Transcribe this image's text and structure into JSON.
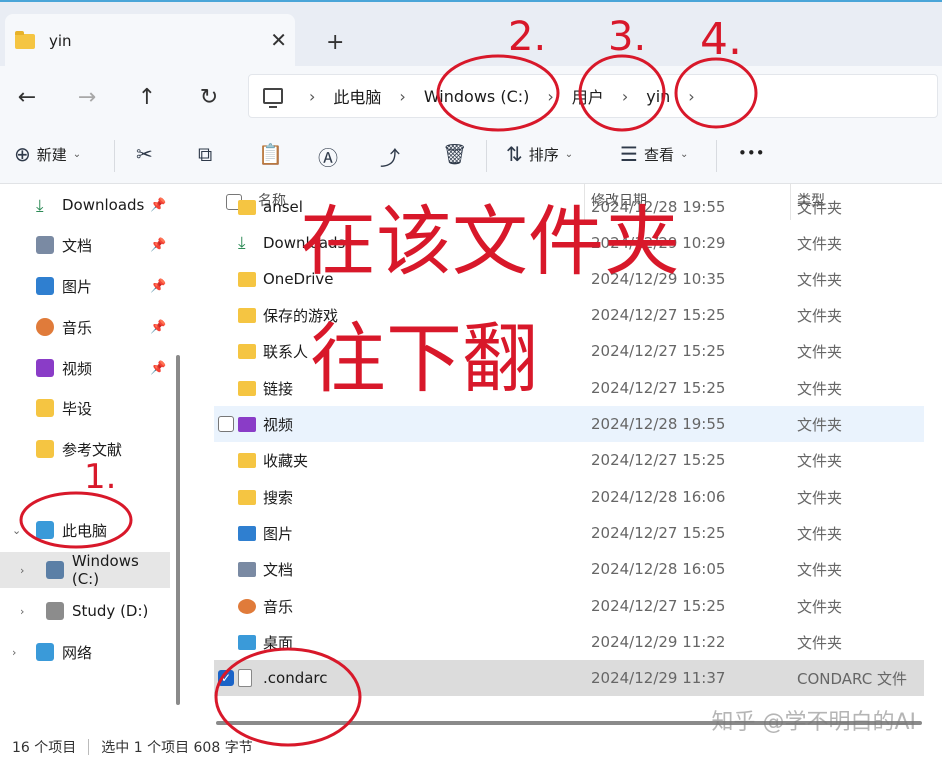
{
  "window": {
    "tab_title": "yin",
    "tab_close": "✕",
    "tab_new": "+"
  },
  "nav": {
    "back": "←",
    "forward": "→",
    "up": "↑",
    "refresh": "↻"
  },
  "breadcrumb": [
    "此电脑",
    "Windows (C:)",
    "用户",
    "yin"
  ],
  "commands": {
    "new_label": "新建",
    "sort_label": "排序",
    "view_label": "查看",
    "more": "•••"
  },
  "sidebar": {
    "items": [
      {
        "label": "Downloads",
        "icon": "download-icon",
        "pinned": true
      },
      {
        "label": "文档",
        "icon": "document-icon",
        "pinned": true
      },
      {
        "label": "图片",
        "icon": "pictures-icon",
        "pinned": true
      },
      {
        "label": "音乐",
        "icon": "music-icon",
        "pinned": true
      },
      {
        "label": "视频",
        "icon": "video-icon",
        "pinned": true
      },
      {
        "label": "毕设",
        "icon": "folder-icon",
        "pinned": false
      },
      {
        "label": "参考文献",
        "icon": "folder-icon",
        "pinned": false
      }
    ],
    "tree": [
      {
        "label": "此电脑",
        "icon": "computer-icon"
      },
      {
        "label": "Windows (C:)",
        "icon": "drive-icon"
      },
      {
        "label": "Study (D:)",
        "icon": "drive-icon"
      },
      {
        "label": "网络",
        "icon": "network-icon"
      }
    ]
  },
  "columns": {
    "name": "名称",
    "date": "修改日期",
    "type": "类型"
  },
  "files": [
    {
      "name": "ansel",
      "date": "2024/12/28 19:55",
      "type": "文件夹",
      "icon": "folder-icon"
    },
    {
      "name": "Downloads",
      "date": "2024/12/29 10:29",
      "type": "文件夹",
      "icon": "download-icon"
    },
    {
      "name": "OneDrive",
      "date": "2024/12/29 10:35",
      "type": "文件夹",
      "icon": "folder-icon"
    },
    {
      "name": "保存的游戏",
      "date": "2024/12/27 15:25",
      "type": "文件夹",
      "icon": "folder-icon"
    },
    {
      "name": "联系人",
      "date": "2024/12/27 15:25",
      "type": "文件夹",
      "icon": "folder-icon"
    },
    {
      "name": "链接",
      "date": "2024/12/27 15:25",
      "type": "文件夹",
      "icon": "folder-icon"
    },
    {
      "name": "视频",
      "date": "2024/12/28 19:55",
      "type": "文件夹",
      "icon": "video-icon"
    },
    {
      "name": "收藏夹",
      "date": "2024/12/27 15:25",
      "type": "文件夹",
      "icon": "folder-icon"
    },
    {
      "name": "搜索",
      "date": "2024/12/28 16:06",
      "type": "文件夹",
      "icon": "folder-icon"
    },
    {
      "name": "图片",
      "date": "2024/12/27 15:25",
      "type": "文件夹",
      "icon": "pictures-icon"
    },
    {
      "name": "文档",
      "date": "2024/12/28 16:05",
      "type": "文件夹",
      "icon": "document-icon"
    },
    {
      "name": "音乐",
      "date": "2024/12/27 15:25",
      "type": "文件夹",
      "icon": "music-icon"
    },
    {
      "name": "桌面",
      "date": "2024/12/29 11:22",
      "type": "文件夹",
      "icon": "desktop-icon"
    },
    {
      "name": ".condarc",
      "date": "2024/12/29 11:37",
      "type": "CONDARC 文件",
      "icon": "file-icon"
    }
  ],
  "status": {
    "count": "16 个项目",
    "selected": "选中 1 个项目 608 字节"
  },
  "watermark": "知乎 @学不明白的AI",
  "annotations": {
    "note_line1": "在该文件夹",
    "note_line2": "往下翻",
    "n1": "1.",
    "n2": "2.",
    "n3": "3.",
    "n4": "4."
  },
  "colors": {
    "accent": "#1a63c7",
    "folder": "#f5c542",
    "annotation_red": "#d8182a",
    "selected_row": "#dcdcdc",
    "hover_row": "#eaf3fd"
  }
}
